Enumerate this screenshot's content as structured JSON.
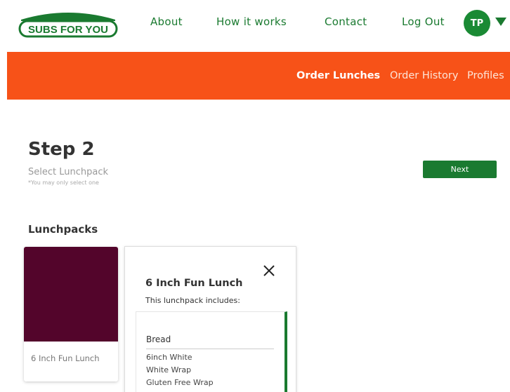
{
  "logo": {
    "text": "SUBS FOR YOU",
    "icon": "sandwich-logo"
  },
  "nav": {
    "about": "About",
    "how_it_works": "How it works",
    "contact": "Contact",
    "logout": "Log Out",
    "avatar_initials": "TP"
  },
  "subnav": {
    "order_lunches": "Order Lunches",
    "order_history": "Order History",
    "profiles": "Profiles"
  },
  "step": {
    "title": "Step 2",
    "subtitle": "Select Lunchpack",
    "note": "*You may only select one",
    "next_label": "Next"
  },
  "lunchpacks": {
    "section_title": "Lunchpacks",
    "items": [
      {
        "name": "6 Inch Fun Lunch",
        "image_color": "#53052b"
      }
    ]
  },
  "detail": {
    "title": "6 Inch Fun Lunch",
    "subtitle": "This lunchpack includes:",
    "groups": [
      {
        "title": "Bread",
        "items": [
          "6inch White",
          "White Wrap",
          "Gluten Free Wrap"
        ]
      }
    ]
  },
  "colors": {
    "brand_green": "#1a7a30",
    "accent_orange": "#f75218",
    "card_image": "#53052b"
  }
}
